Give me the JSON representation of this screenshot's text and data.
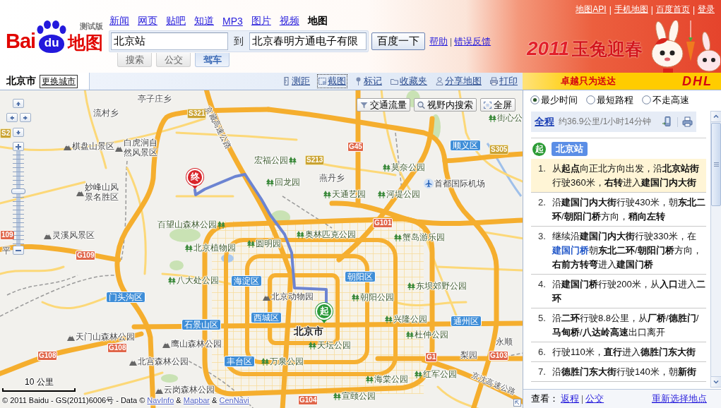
{
  "header": {
    "logo": {
      "left": "Bai",
      "paw": "du",
      "right": "地图",
      "edition": "测试版"
    },
    "nav": [
      {
        "label": "新闻",
        "selected": false
      },
      {
        "label": "网页",
        "selected": false
      },
      {
        "label": "贴吧",
        "selected": false
      },
      {
        "label": "知道",
        "selected": false
      },
      {
        "label": "MP3",
        "selected": false
      },
      {
        "label": "图片",
        "selected": false
      },
      {
        "label": "视频",
        "selected": false
      },
      {
        "label": "地图",
        "selected": true
      }
    ],
    "search": {
      "from": "北京站",
      "connector": "到",
      "to": "北京春明方通电子有限",
      "button": "百度一下",
      "links": [
        "帮助",
        "错误反馈"
      ],
      "separator": "|"
    },
    "search_tabs": [
      {
        "label": "搜索",
        "selected": false
      },
      {
        "label": "公交",
        "selected": false
      },
      {
        "label": "驾车",
        "selected": true
      }
    ],
    "top_links": {
      "items": [
        "地图API",
        "手机地图",
        "百度首页",
        "登录"
      ],
      "separator": "|"
    },
    "banner": {
      "year": "2011",
      "slogan": "玉兔迎春"
    }
  },
  "toolbar": {
    "city": "北京市",
    "change_city": "更换城市",
    "tools": [
      {
        "kind": "ruler",
        "label": "测距",
        "selected": false
      },
      {
        "kind": "screenshot",
        "label": "截图",
        "selected": true
      },
      {
        "kind": "marker",
        "label": "标记",
        "selected": false
      },
      {
        "kind": "folder",
        "label": "收藏夹",
        "selected": false
      },
      {
        "kind": "share",
        "label": "分享地图",
        "selected": false
      },
      {
        "kind": "print",
        "label": "打印",
        "selected": false
      }
    ],
    "ad": {
      "slogan": "卓越只为送达",
      "brand": "DHL"
    }
  },
  "map": {
    "controls": [
      {
        "kind": "traffic",
        "label": "交通流量"
      },
      {
        "kind": "search",
        "label": "视野内搜索"
      },
      {
        "kind": "fullscreen",
        "label": "全屏"
      }
    ],
    "zoom": {
      "level": 0.58
    },
    "labels": [
      {
        "kind": "town",
        "text": "亭子庄乡"
      },
      {
        "kind": "town",
        "text": "流村乡"
      },
      {
        "kind": "provincial",
        "text": "S321"
      },
      {
        "kind": "provincial",
        "text": "S2"
      },
      {
        "kind": "scenic",
        "text": "棋盘山景区"
      },
      {
        "kind": "scenic",
        "text": "白虎涧自然风景区"
      },
      {
        "kind": "highway",
        "text": "京藏高速公路"
      },
      {
        "kind": "park",
        "text": "街心公"
      },
      {
        "kind": "national",
        "text": "G45"
      },
      {
        "kind": "district",
        "text": "顺义区"
      },
      {
        "kind": "provincial",
        "text": "S305"
      },
      {
        "kind": "park",
        "text": "宏福公园"
      },
      {
        "kind": "provincial",
        "text": "S213"
      },
      {
        "kind": "park",
        "text": "莫奈公园"
      },
      {
        "kind": "scenic",
        "text": "妙峰山风景名胜区"
      },
      {
        "kind": "park",
        "text": "回龙园"
      },
      {
        "kind": "town",
        "text": "燕丹乡"
      },
      {
        "kind": "airport",
        "text": "首都国际机场"
      },
      {
        "kind": "park",
        "text": "天通艺园"
      },
      {
        "kind": "park",
        "text": "河堤公园"
      },
      {
        "kind": "park",
        "text": "百望山森林公园"
      },
      {
        "kind": "national",
        "text": "G101"
      },
      {
        "kind": "national",
        "text": "109"
      },
      {
        "kind": "scenic",
        "text": "灵溪风景区"
      },
      {
        "kind": "town",
        "text": "平"
      },
      {
        "kind": "national",
        "text": "G109"
      },
      {
        "kind": "park",
        "text": "北京植物园"
      },
      {
        "kind": "park",
        "text": "圆明园"
      },
      {
        "kind": "park",
        "text": "奥林匹克公园"
      },
      {
        "kind": "park",
        "text": "蟹岛游乐园"
      },
      {
        "kind": "park",
        "text": "八大处公园"
      },
      {
        "kind": "district",
        "text": "海淀区"
      },
      {
        "kind": "district",
        "text": "朝阳区"
      },
      {
        "kind": "park",
        "text": "东坝郊野公园"
      },
      {
        "kind": "district",
        "text": "门头沟区"
      },
      {
        "kind": "scenic",
        "text": "北京动物园"
      },
      {
        "kind": "park",
        "text": "朝阳公园"
      },
      {
        "kind": "district",
        "text": "石景山区"
      },
      {
        "kind": "district",
        "text": "西城区"
      },
      {
        "kind": "park",
        "text": "兴隆公园"
      },
      {
        "kind": "scenic",
        "text": "天门山森林公园"
      },
      {
        "kind": "city",
        "text": "北京市"
      },
      {
        "kind": "district",
        "text": "通州区"
      },
      {
        "kind": "national",
        "text": "G108"
      },
      {
        "kind": "national",
        "text": "G108"
      },
      {
        "kind": "scenic",
        "text": "鹰山森林公园"
      },
      {
        "kind": "park",
        "text": "杜仲公园"
      },
      {
        "kind": "park",
        "text": "天坛公园"
      },
      {
        "kind": "town",
        "text": "永顺"
      },
      {
        "kind": "scenic",
        "text": "北宫森林公园"
      },
      {
        "kind": "district",
        "text": "丰台区"
      },
      {
        "kind": "park",
        "text": "万泉公园"
      },
      {
        "kind": "national",
        "text": "G1"
      },
      {
        "kind": "town",
        "text": "梨园"
      },
      {
        "kind": "national",
        "text": "G103"
      },
      {
        "kind": "park",
        "text": "海棠公园"
      },
      {
        "kind": "park",
        "text": "红军公园"
      },
      {
        "kind": "scenic",
        "text": "云岗森林公园"
      },
      {
        "kind": "national",
        "text": "G104"
      },
      {
        "kind": "park",
        "text": "宣颐公园"
      },
      {
        "kind": "highway",
        "text": "京沈高速公路"
      }
    ],
    "markers": [
      {
        "kind": "end",
        "text": "终"
      },
      {
        "kind": "start",
        "text": "起"
      }
    ],
    "scale": "10 公里",
    "copyright": {
      "text": "© 2011 Baidu - GS(2011)6006号 - Data ©",
      "links": [
        "NavInfo",
        "Mapbar",
        "CenNavi"
      ],
      "separator": "&"
    }
  },
  "route_panel": {
    "options": [
      {
        "label": "最少时间",
        "selected": true
      },
      {
        "label": "最短路程",
        "selected": false
      },
      {
        "label": "不走高速",
        "selected": false
      }
    ],
    "summary": {
      "link": "全程",
      "text": "约36.9公里/1小时14分钟"
    },
    "start": {
      "marker": "起",
      "name": "北京站"
    },
    "steps": [
      {
        "number": "1.",
        "text": "从**起点**向正北方向出发，沿**北京站街**行驶360米，**右转**进入**建国门内大街**",
        "selected": true
      },
      {
        "number": "2.",
        "text": "沿**建国门内大街**行驶430米，朝**东北二环**/**朝阳门桥**方向，**稍向左转**",
        "selected": false
      },
      {
        "number": "3.",
        "text": "继续沿**建国门内大街**行驶330米，在",
        "link": "建国门桥",
        "text_after": "朝**东北二环**/**朝阳门桥**方向，**右前方转弯**进入**建国门桥**",
        "selected": false
      },
      {
        "number": "4.",
        "text": "沿**建国门桥**行驶200米，从**入口**进入**二环**",
        "selected": false
      },
      {
        "number": "5.",
        "text": "沿**二环**行驶8.8公里，从**厂桥**/**德胜门**/**马甸桥**/**八达岭高速**出口离开",
        "selected": false
      },
      {
        "number": "6.",
        "text": "行驶110米，**直行**进入**德胜门东大街**",
        "selected": false
      },
      {
        "number": "7.",
        "text": "沿**德胜门东大街**行驶140米，朝**新街**",
        "selected": false
      }
    ],
    "footer": {
      "label": "查看：",
      "links": [
        "返程",
        "公交"
      ],
      "separator": "|",
      "reselect": "重新选择地点"
    }
  }
}
